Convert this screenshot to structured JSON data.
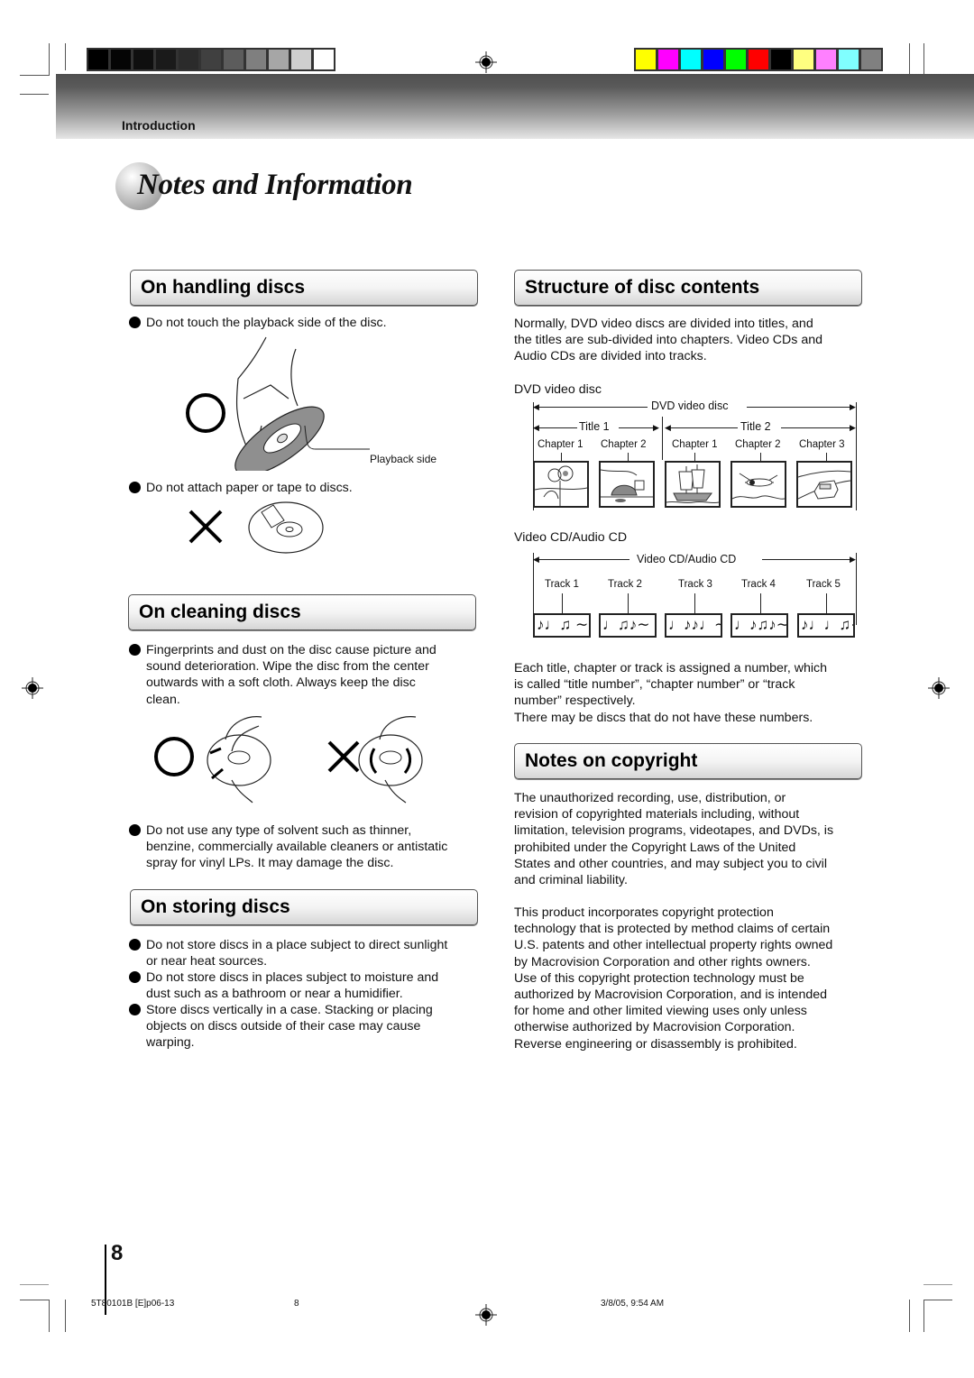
{
  "header": {
    "section_label": "Introduction",
    "page_title": "Notes and Information",
    "gray_swatches": [
      "#000000",
      "#050505",
      "#0f0f0f",
      "#1a1a1a",
      "#2b2b2b",
      "#404040",
      "#5c5c5c",
      "#7f7f7f",
      "#a6a6a6",
      "#cfcfcf",
      "#ffffff"
    ],
    "color_swatches": [
      "#ffff00",
      "#ff00ff",
      "#00ffff",
      "#0000ff",
      "#00ff00",
      "#ff0000",
      "#000000",
      "#ffff80",
      "#ff80ff",
      "#80ffff",
      "#808080"
    ]
  },
  "handling": {
    "heading": "On handling discs",
    "bullet1": "Do not touch the playback side of the disc.",
    "playback_label": "Playback side",
    "bullet2": "Do not attach paper or tape to discs."
  },
  "cleaning": {
    "heading": "On cleaning discs",
    "bullet1_lines": [
      "Fingerprints and dust on the disc cause picture and",
      "sound deterioration. Wipe the disc from the center",
      "outwards with a soft cloth. Always keep the disc",
      "clean."
    ],
    "bullet2_lines": [
      "Do not use any type of solvent such as thinner,",
      "benzine, commercially available cleaners or antistatic",
      "spray for vinyl LPs. It may damage the disc."
    ]
  },
  "storing": {
    "heading": "On storing discs",
    "bullets": [
      [
        "Do not store discs in a place subject to direct sunlight",
        "or near heat sources."
      ],
      [
        "Do not store discs in places subject to moisture and",
        "dust such as a bathroom or near a humidifier."
      ],
      [
        "Store discs vertically in a case. Stacking or placing",
        "objects on discs outside of their case may cause",
        "warping."
      ]
    ]
  },
  "structure": {
    "heading": "Structure of disc contents",
    "intro_lines": [
      "Normally, DVD video discs are divided into titles, and",
      "the titles are sub-divided into chapters. Video CDs and",
      "Audio CDs are divided into tracks."
    ],
    "dvd_caption": "DVD video disc",
    "dvd_span_label": "DVD video disc",
    "titles": [
      "Title 1",
      "Title 2"
    ],
    "chapters": [
      "Chapter 1",
      "Chapter 2",
      "Chapter 1",
      "Chapter 2",
      "Chapter 3"
    ],
    "chapter_images": [
      "sunflowers",
      "cat",
      "sailing-ship",
      "airplane",
      "car"
    ],
    "cd_caption": "Video CD/Audio CD",
    "cd_span_label": "Video CD/Audio CD",
    "tracks": [
      "Track 1",
      "Track 2",
      "Track 3",
      "Track 4",
      "Track 5"
    ],
    "track_notes": [
      "♪♩♫ ∼",
      "♩♫♪∼",
      "♩♪♪♩∼",
      "♩♪♫♪∼",
      "♪♩♩♫∼"
    ],
    "numbering_lines": [
      "Each title, chapter or track is assigned a number, which",
      "is called “title number”, “chapter number” or “track",
      "number” respectively."
    ],
    "note": "There may be discs that do not have these numbers."
  },
  "copyright": {
    "heading": "Notes on copyright",
    "para1_lines": [
      "The unauthorized recording, use, distribution, or",
      "revision of copyrighted materials including, without",
      "limitation, television programs, videotapes, and DVDs, is",
      "prohibited under the Copyright Laws of the United",
      "States and other countries, and may subject you to civil",
      "and criminal liability."
    ],
    "para2_lines": [
      "This product incorporates copyright protection",
      "technology that is protected by method claims of certain",
      "U.S. patents and other intellectual property rights owned",
      "by Macrovision Corporation and other rights owners.",
      "Use of this copyright protection technology must be",
      "authorized by Macrovision Corporation, and is intended",
      "for home and other limited viewing uses only unless",
      "otherwise authorized by Macrovision Corporation.",
      "Reverse engineering or disassembly is prohibited."
    ]
  },
  "footer": {
    "page_number": "8",
    "file_id": "5T80101B [E]p06-13",
    "slug_page": "8",
    "timestamp": "3/8/05, 9:54 AM"
  }
}
